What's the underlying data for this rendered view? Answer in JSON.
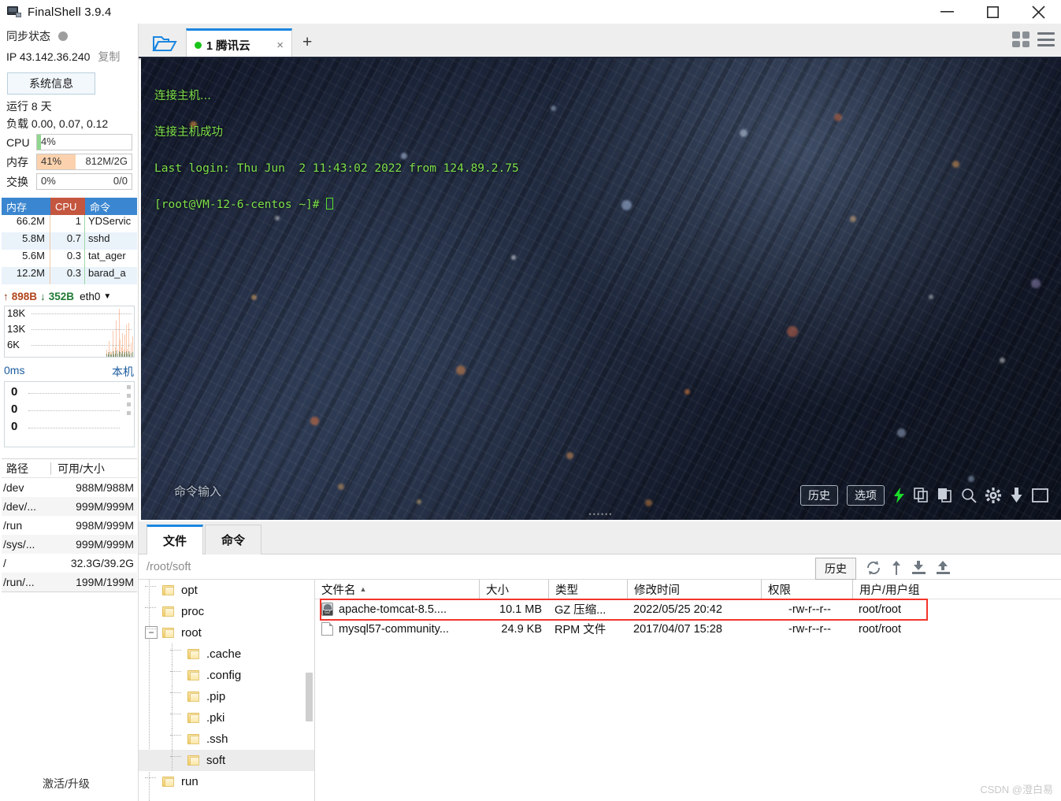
{
  "window": {
    "title": "FinalShell 3.9.4",
    "icon": "monitor-icon",
    "minimize": "minimize-icon",
    "maximize": "maximize-icon",
    "close": "close-icon"
  },
  "sidebar": {
    "sync_label": "同步状态",
    "ip_label": "IP 43.142.36.240",
    "ip_copy": "复制",
    "sysinfo_button": "系统信息",
    "uptime": "运行 8 天",
    "load": "负载 0.00, 0.07, 0.12",
    "meters": [
      {
        "name": "CPU",
        "percent": "4%",
        "right": "",
        "fill_pct": 4,
        "color": "#8fd78f"
      },
      {
        "name": "内存",
        "percent": "41%",
        "right": "812M/2G",
        "fill_pct": 41,
        "color": "#fbd2ad"
      },
      {
        "name": "交换",
        "percent": "0%",
        "right": "0/0",
        "fill_pct": 0,
        "color": "#cfe8cf"
      }
    ],
    "process_table": {
      "headers": [
        "内存",
        "CPU",
        "命令"
      ],
      "rows": [
        {
          "mem": "66.2M",
          "cpu": "1",
          "cmd": "YDServic"
        },
        {
          "mem": "5.8M",
          "cpu": "0.7",
          "cmd": "sshd"
        },
        {
          "mem": "5.6M",
          "cpu": "0.3",
          "cmd": "tat_ager"
        },
        {
          "mem": "12.2M",
          "cpu": "0.3",
          "cmd": "barad_a"
        }
      ]
    },
    "network": {
      "up": "898B",
      "down": "352B",
      "interface": "eth0",
      "y_labels": [
        "18K",
        "13K",
        "6K"
      ]
    },
    "latency": {
      "value": "0ms",
      "target": "本机",
      "y_labels": [
        "0",
        "0",
        "0"
      ]
    },
    "disk_table": {
      "headers": [
        "路径",
        "可用/大小"
      ],
      "rows": [
        {
          "path": "/dev",
          "size": "988M/988M"
        },
        {
          "path": "/dev/...",
          "size": "999M/999M"
        },
        {
          "path": "/run",
          "size": "998M/999M"
        },
        {
          "path": "/sys/...",
          "size": "999M/999M"
        },
        {
          "path": "/",
          "size": "32.3G/39.2G"
        },
        {
          "path": "/run/...",
          "size": "199M/199M"
        }
      ]
    },
    "activate": "激活/升级"
  },
  "tabbar": {
    "open_folder": "open-folder-icon",
    "tab_label": "1 腾讯云",
    "tab_close": "×",
    "new_tab": "+",
    "grid_view": "grid-view-icon",
    "menu": "hamburger-menu-icon"
  },
  "terminal": {
    "lines": [
      "连接主机...",
      "连接主机成功",
      "Last login: Thu Jun  2 11:43:02 2022 from 124.89.2.75",
      "[root@VM-12-6-centos ~]# "
    ],
    "command_placeholder": "命令输入",
    "buttons": [
      {
        "name": "history-button",
        "label": "历史"
      },
      {
        "name": "options-button",
        "label": "选项"
      }
    ],
    "icons": [
      "bolt-icon",
      "copy-icon",
      "paste-icon",
      "search-icon",
      "gear-icon",
      "download-icon",
      "window-icon"
    ]
  },
  "filepanel": {
    "tabs": [
      {
        "label": "文件",
        "active": true
      },
      {
        "label": "命令",
        "active": false
      }
    ],
    "path": "/root/soft",
    "history_button": "历史",
    "toolbar_icons": [
      "refresh-icon",
      "sort-icon",
      "download-icon",
      "upload-icon"
    ],
    "tree": [
      {
        "label": "opt",
        "depth": 1,
        "expander": "",
        "selected": false
      },
      {
        "label": "proc",
        "depth": 1,
        "expander": "",
        "selected": false
      },
      {
        "label": "root",
        "depth": 1,
        "expander": "−",
        "selected": false
      },
      {
        "label": ".cache",
        "depth": 2,
        "expander": "",
        "selected": false
      },
      {
        "label": ".config",
        "depth": 2,
        "expander": "",
        "selected": false
      },
      {
        "label": ".pip",
        "depth": 2,
        "expander": "",
        "selected": false
      },
      {
        "label": ".pki",
        "depth": 2,
        "expander": "",
        "selected": false
      },
      {
        "label": ".ssh",
        "depth": 2,
        "expander": "",
        "selected": false
      },
      {
        "label": "soft",
        "depth": 2,
        "expander": "",
        "selected": true
      },
      {
        "label": "run",
        "depth": 1,
        "expander": "",
        "selected": false
      }
    ],
    "list_headers": [
      "文件名",
      "大小",
      "类型",
      "修改时间",
      "权限",
      "用户/用户组"
    ],
    "sort_indicator": "▲",
    "files": [
      {
        "icon": "gz-archive-icon",
        "name": "apache-tomcat-8.5....",
        "size": "10.1 MB",
        "type": "GZ 压缩...",
        "modified": "2022/05/25 20:42",
        "permissions": "-rw-r--r--",
        "owner": "root/root",
        "highlighted": true
      },
      {
        "icon": "file-icon",
        "name": "mysql57-community...",
        "size": "24.9 KB",
        "type": "RPM 文件",
        "modified": "2017/04/07 15:28",
        "permissions": "-rw-r--r--",
        "owner": "root/root",
        "highlighted": false
      }
    ],
    "highlight_color": "#f4342a"
  },
  "watermark": "CSDN @澄白易"
}
